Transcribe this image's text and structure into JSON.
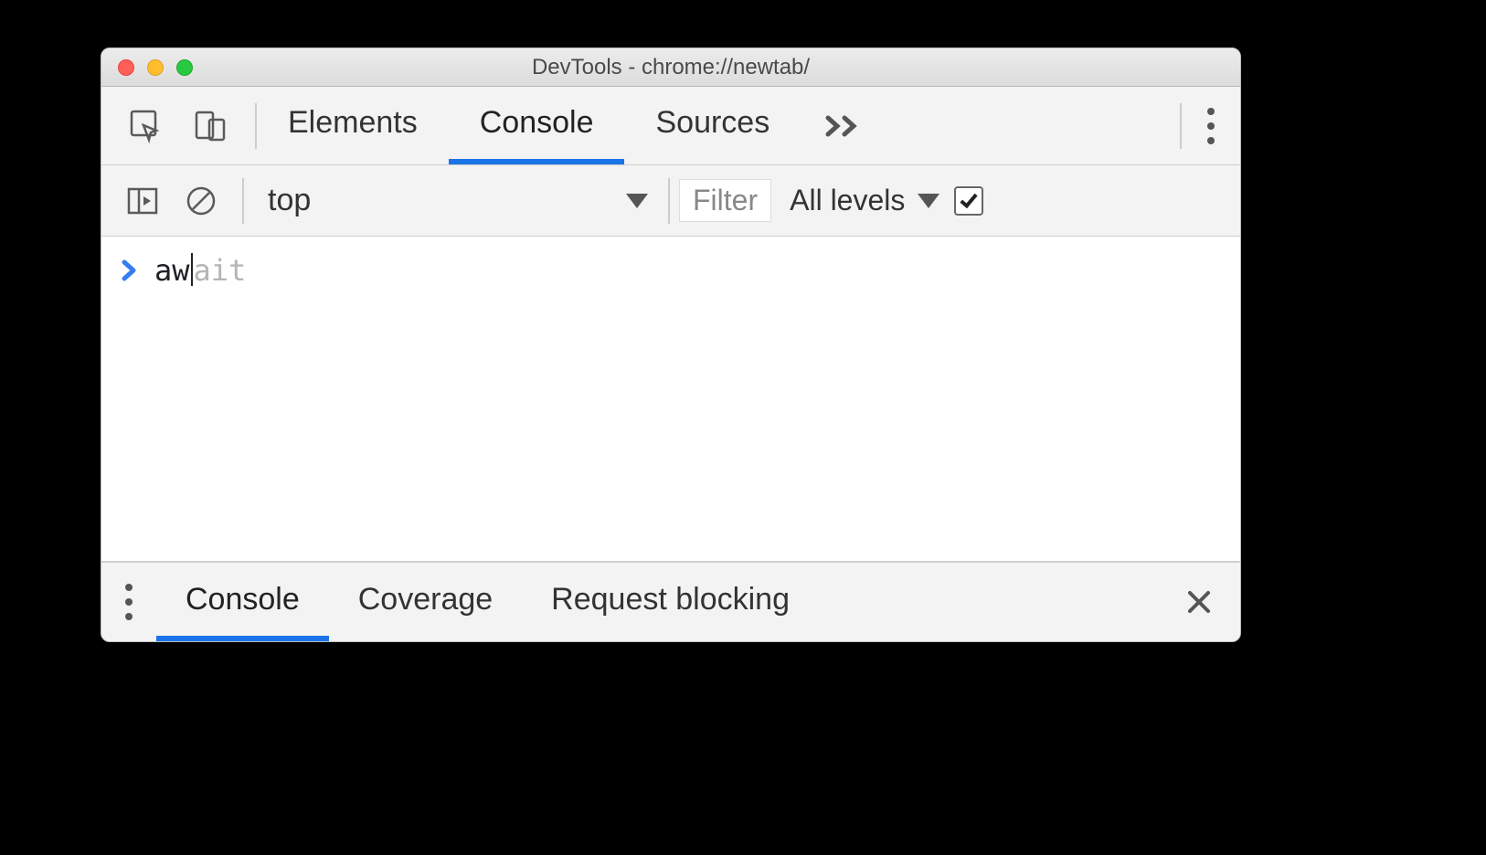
{
  "window": {
    "title": "DevTools - chrome://newtab/"
  },
  "tabs": {
    "elements": "Elements",
    "console": "Console",
    "sources": "Sources"
  },
  "consoleBar": {
    "context": "top",
    "filterPlaceholder": "Filter",
    "levels": "All levels"
  },
  "consoleInput": {
    "typed": "aw",
    "suggestion": "ait"
  },
  "drawer": {
    "console": "Console",
    "coverage": "Coverage",
    "requestBlocking": "Request blocking"
  }
}
